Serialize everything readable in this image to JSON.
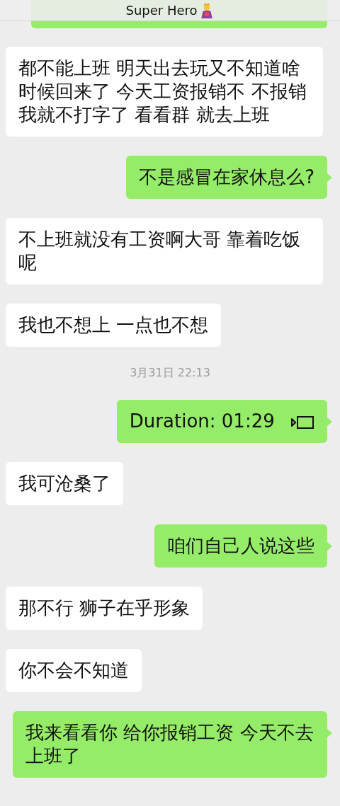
{
  "header": {
    "title": "Super Hero"
  },
  "messages": [
    {
      "kind": "text",
      "sent": false,
      "text": "都不能上班 明天出去玩又不知道啥时候回来了 今天工资报销不 不报销我就不打字了 看看群 就去上班"
    },
    {
      "kind": "text",
      "sent": true,
      "text": "不是感冒在家休息么?"
    },
    {
      "kind": "text",
      "sent": false,
      "text": "不上班就没有工资啊大哥 靠着吃饭呢"
    },
    {
      "kind": "text",
      "sent": false,
      "text": "我也不想上 一点也不想"
    },
    {
      "kind": "time",
      "text": "3月31日 22:13"
    },
    {
      "kind": "call",
      "sent": true,
      "text": "Duration: 01:29"
    },
    {
      "kind": "text",
      "sent": false,
      "text": "我可沧桑了"
    },
    {
      "kind": "text",
      "sent": true,
      "text": "咱们自己人说这些"
    },
    {
      "kind": "text",
      "sent": false,
      "text": "那不行 狮子在乎形象"
    },
    {
      "kind": "text",
      "sent": false,
      "text": "你不会不知道"
    },
    {
      "kind": "text",
      "sent": true,
      "text": "我来看看你 给你报销工资 今天不去上班了"
    }
  ]
}
